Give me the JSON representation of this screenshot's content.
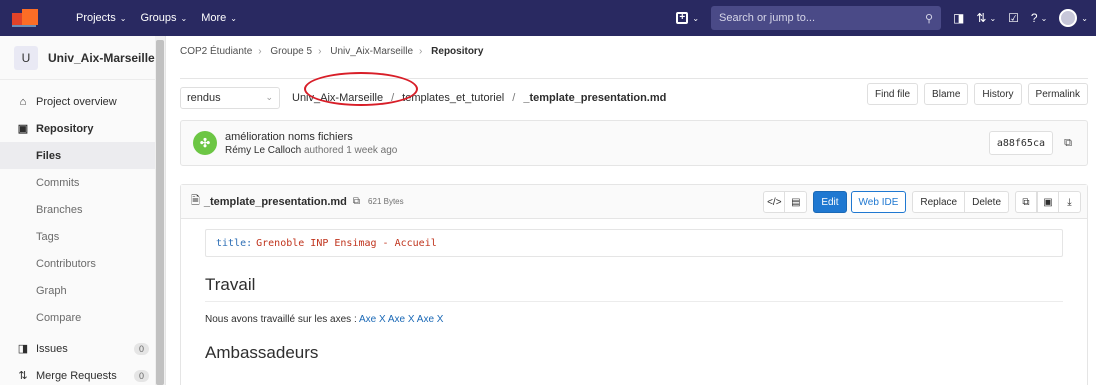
{
  "topbar": {
    "nav": [
      "Projects",
      "Groups",
      "More"
    ],
    "search_placeholder": "Search or jump to..."
  },
  "sidebar": {
    "project_initial": "U",
    "project_name": "Univ_Aix-Marseille",
    "items": {
      "overview": "Project overview",
      "repository": "Repository",
      "sub": [
        "Files",
        "Commits",
        "Branches",
        "Tags",
        "Contributors",
        "Graph",
        "Compare"
      ],
      "issues": "Issues",
      "issues_count": "0",
      "merge_requests": "Merge Requests",
      "mr_count": "0"
    }
  },
  "breadcrumb": [
    "COP2 Étudiante",
    "Groupe 5",
    "Univ_Aix-Marseille",
    "Repository"
  ],
  "tree": {
    "branch": "rendus",
    "path": [
      "Univ_Aix-Marseille",
      "templates_et_tutoriel"
    ],
    "file": "_template_presentation.md",
    "buttons": [
      "Find file",
      "Blame",
      "History",
      "Permalink"
    ]
  },
  "commit": {
    "title": "amélioration noms fichiers",
    "author": "Rémy Le Calloch",
    "action": "authored",
    "ago": "1 week ago",
    "sha": "a88f65ca"
  },
  "file": {
    "name": "_template_presentation.md",
    "size": "621 Bytes",
    "edit": "Edit",
    "web_ide": "Web IDE",
    "replace": "Replace",
    "delete": "Delete"
  },
  "content": {
    "yaml_key": "title:",
    "yaml_value": "Grenoble INP Ensimag - Accueil",
    "heading1": "Travail",
    "para_text": "Nous avons travaillé sur les axes : ",
    "para_links": "Axe X Axe X Axe X",
    "heading2": "Ambassadeurs"
  },
  "colors": {
    "navbar": "#292961",
    "primary": "#1f78d1",
    "annotation": "#d81e28"
  }
}
